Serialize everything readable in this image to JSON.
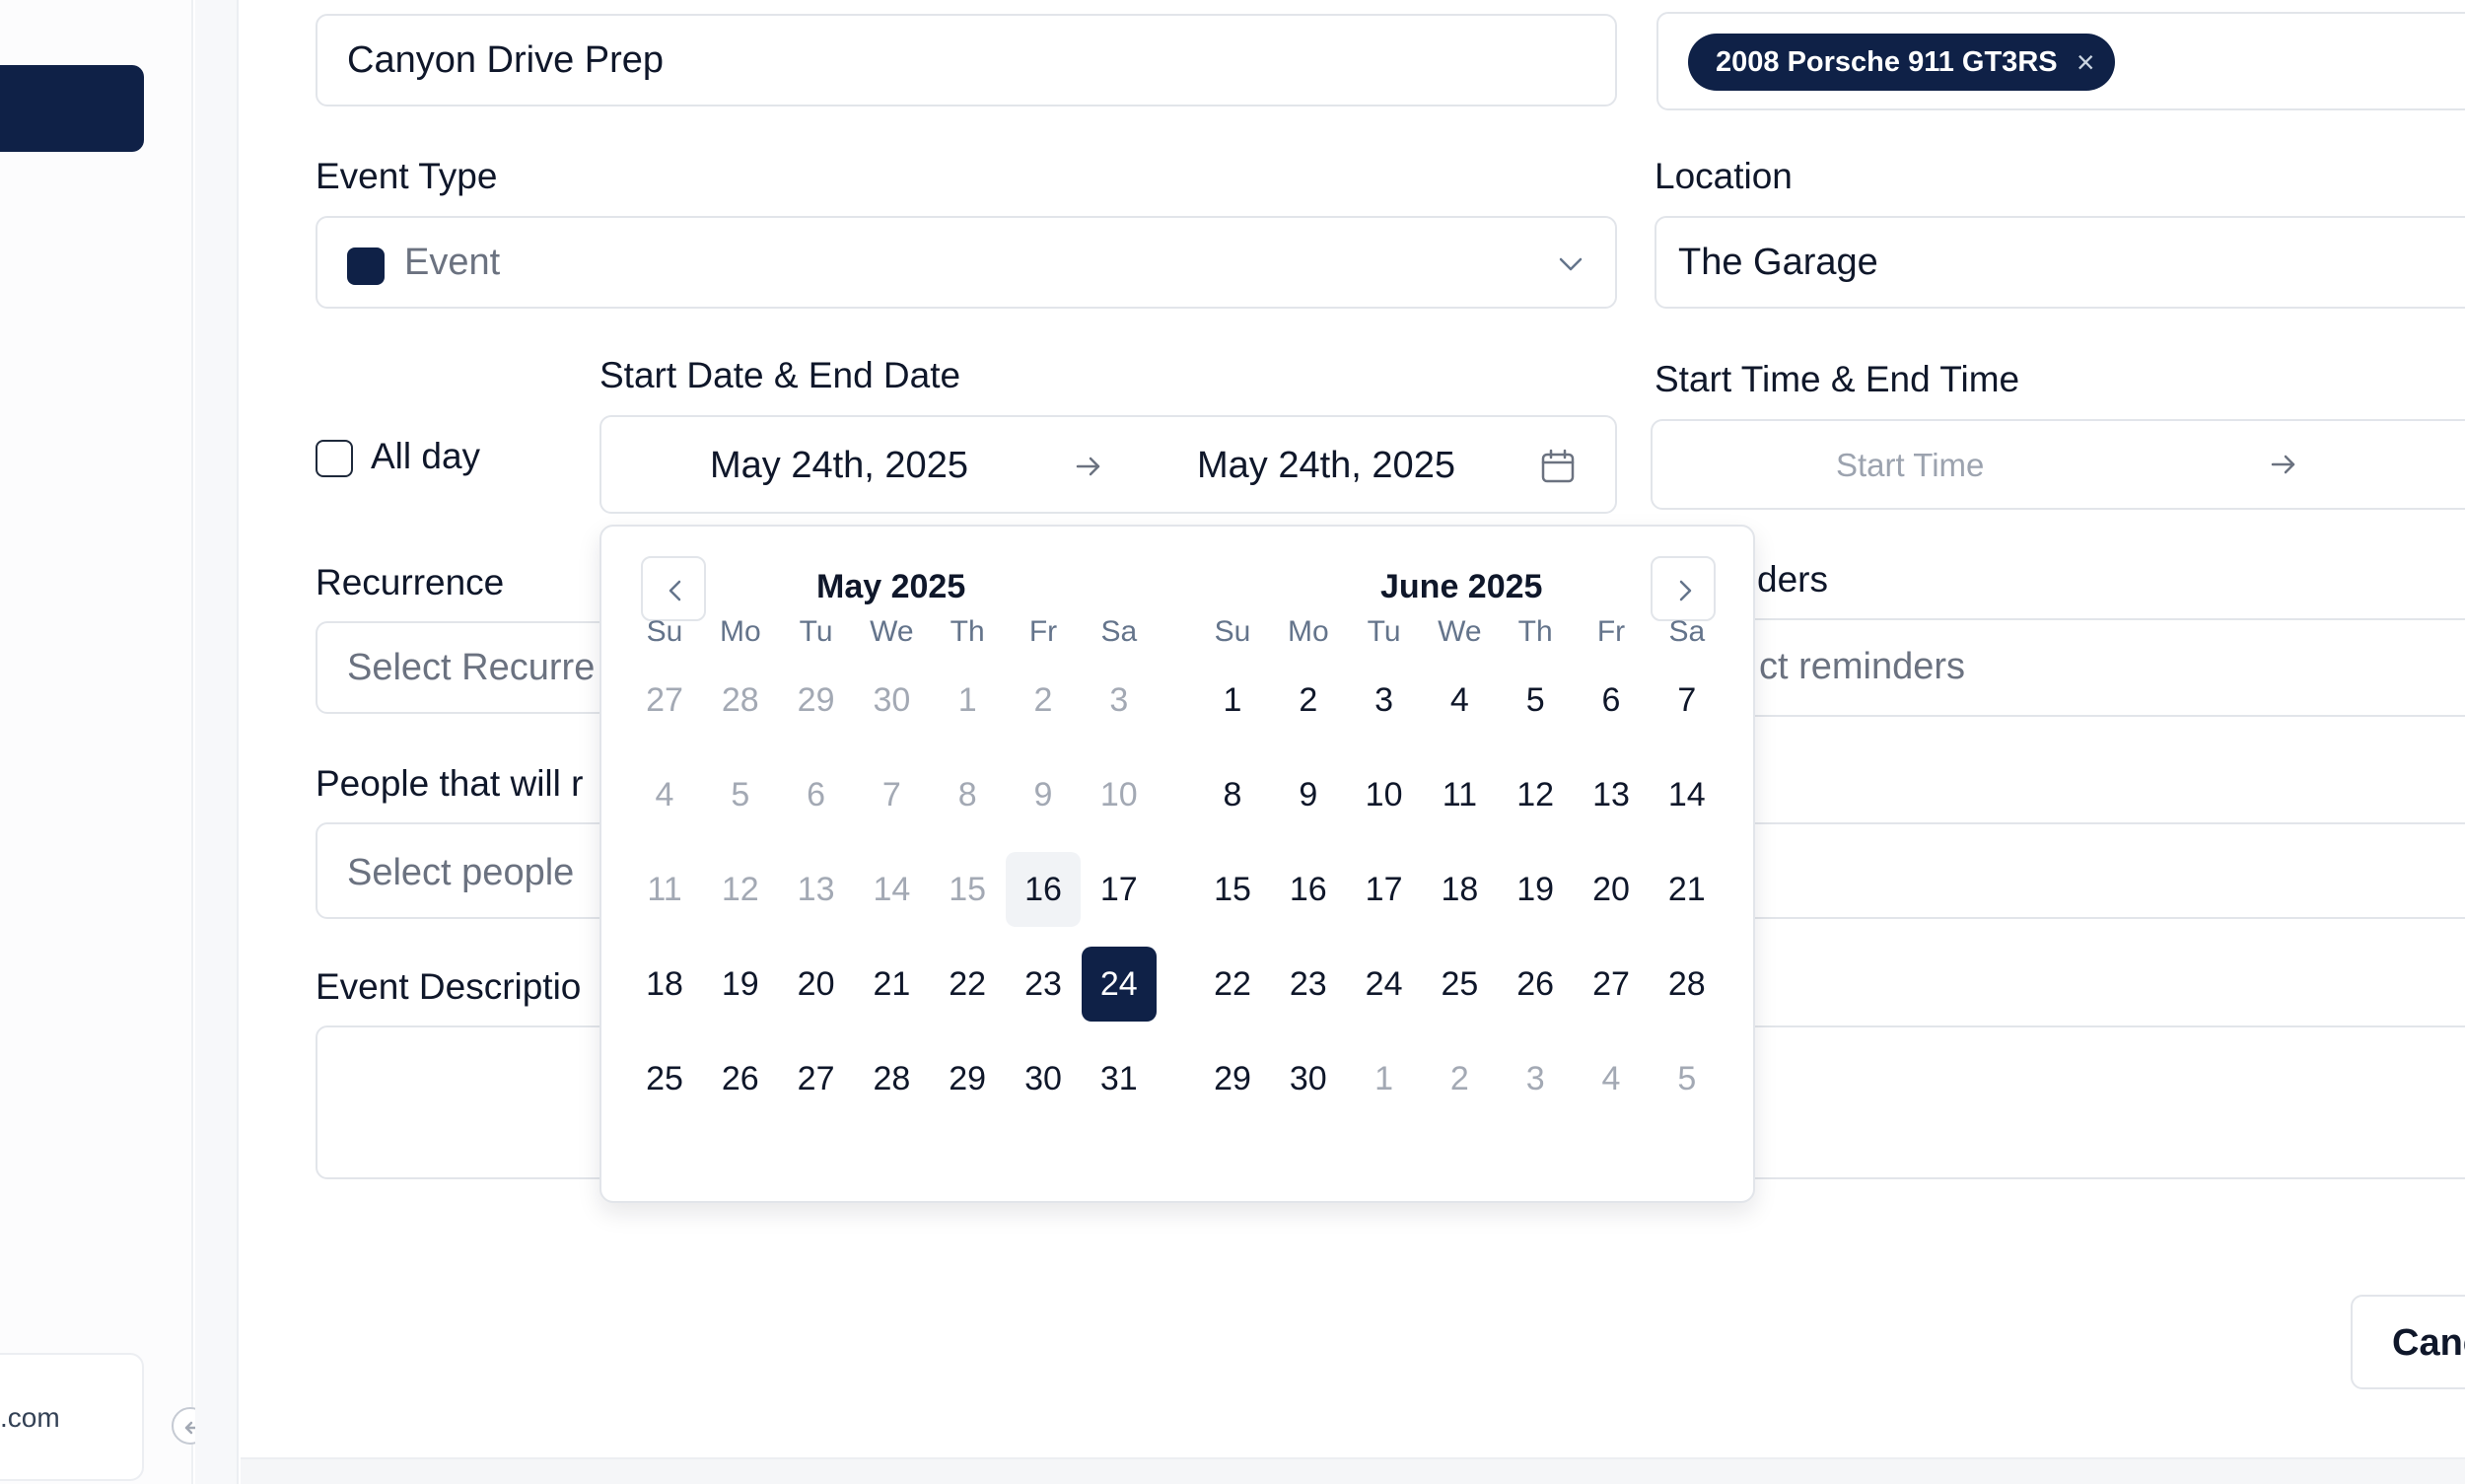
{
  "colors": {
    "brand": "#0f2147",
    "border": "#e2e5ea",
    "muted": "#6b7280"
  },
  "sidebar": {
    "account_email": ".com"
  },
  "form": {
    "event_name": {
      "value": "Canyon Drive Prep"
    },
    "vehicle_tag": {
      "label": "2008 Porsche 911 GT3RS",
      "remove_icon": "close-icon"
    },
    "event_type": {
      "label": "Event Type",
      "value": "Event",
      "icon": "chevron-down-icon"
    },
    "location": {
      "label": "Location",
      "value": "The Garage"
    },
    "all_day": {
      "label": "All day",
      "checked": false
    },
    "date_range": {
      "label": "Start Date & End Date",
      "start": "May 24th, 2025",
      "end": "May 24th, 2025",
      "icon": "calendar-icon"
    },
    "time_range": {
      "label": "Start Time & End Time",
      "start_placeholder": "Start Time"
    },
    "recurrence": {
      "label": "Recurrence",
      "placeholder": "Select Recurre"
    },
    "reminders": {
      "label": "ders",
      "placeholder": "ct reminders"
    },
    "people": {
      "label": "People that will r",
      "placeholder": "Select people"
    },
    "description": {
      "label": "Event Descriptio"
    },
    "cancel_label": "Canc"
  },
  "datepicker": {
    "weekdays": [
      "Su",
      "Mo",
      "Tu",
      "We",
      "Th",
      "Fr",
      "Sa"
    ],
    "months": [
      {
        "title": "May 2025",
        "weeks": [
          [
            {
              "d": "27",
              "out": true
            },
            {
              "d": "28",
              "out": true
            },
            {
              "d": "29",
              "out": true
            },
            {
              "d": "30",
              "out": true
            },
            {
              "d": "1",
              "out": true
            },
            {
              "d": "2",
              "out": true
            },
            {
              "d": "3",
              "out": true
            }
          ],
          [
            {
              "d": "4",
              "out": true
            },
            {
              "d": "5",
              "out": true
            },
            {
              "d": "6",
              "out": true
            },
            {
              "d": "7",
              "out": true
            },
            {
              "d": "8",
              "out": true
            },
            {
              "d": "9",
              "out": true
            },
            {
              "d": "10",
              "out": true
            }
          ],
          [
            {
              "d": "11",
              "out": true
            },
            {
              "d": "12",
              "out": true
            },
            {
              "d": "13",
              "out": true
            },
            {
              "d": "14",
              "out": true
            },
            {
              "d": "15",
              "out": true
            },
            {
              "d": "16",
              "today": true
            },
            {
              "d": "17"
            }
          ],
          [
            {
              "d": "18"
            },
            {
              "d": "19"
            },
            {
              "d": "20"
            },
            {
              "d": "21"
            },
            {
              "d": "22"
            },
            {
              "d": "23"
            },
            {
              "d": "24",
              "selected": true
            }
          ],
          [
            {
              "d": "25"
            },
            {
              "d": "26"
            },
            {
              "d": "27"
            },
            {
              "d": "28"
            },
            {
              "d": "29"
            },
            {
              "d": "30"
            },
            {
              "d": "31"
            }
          ]
        ]
      },
      {
        "title": "June 2025",
        "weeks": [
          [
            {
              "d": "1"
            },
            {
              "d": "2"
            },
            {
              "d": "3"
            },
            {
              "d": "4"
            },
            {
              "d": "5"
            },
            {
              "d": "6"
            },
            {
              "d": "7"
            }
          ],
          [
            {
              "d": "8"
            },
            {
              "d": "9"
            },
            {
              "d": "10"
            },
            {
              "d": "11"
            },
            {
              "d": "12"
            },
            {
              "d": "13"
            },
            {
              "d": "14"
            }
          ],
          [
            {
              "d": "15"
            },
            {
              "d": "16"
            },
            {
              "d": "17"
            },
            {
              "d": "18"
            },
            {
              "d": "19"
            },
            {
              "d": "20"
            },
            {
              "d": "21"
            }
          ],
          [
            {
              "d": "22"
            },
            {
              "d": "23"
            },
            {
              "d": "24"
            },
            {
              "d": "25"
            },
            {
              "d": "26"
            },
            {
              "d": "27"
            },
            {
              "d": "28"
            }
          ],
          [
            {
              "d": "29"
            },
            {
              "d": "30"
            },
            {
              "d": "1",
              "out": true
            },
            {
              "d": "2",
              "out": true
            },
            {
              "d": "3",
              "out": true
            },
            {
              "d": "4",
              "out": true
            },
            {
              "d": "5",
              "out": true
            }
          ]
        ]
      }
    ]
  }
}
